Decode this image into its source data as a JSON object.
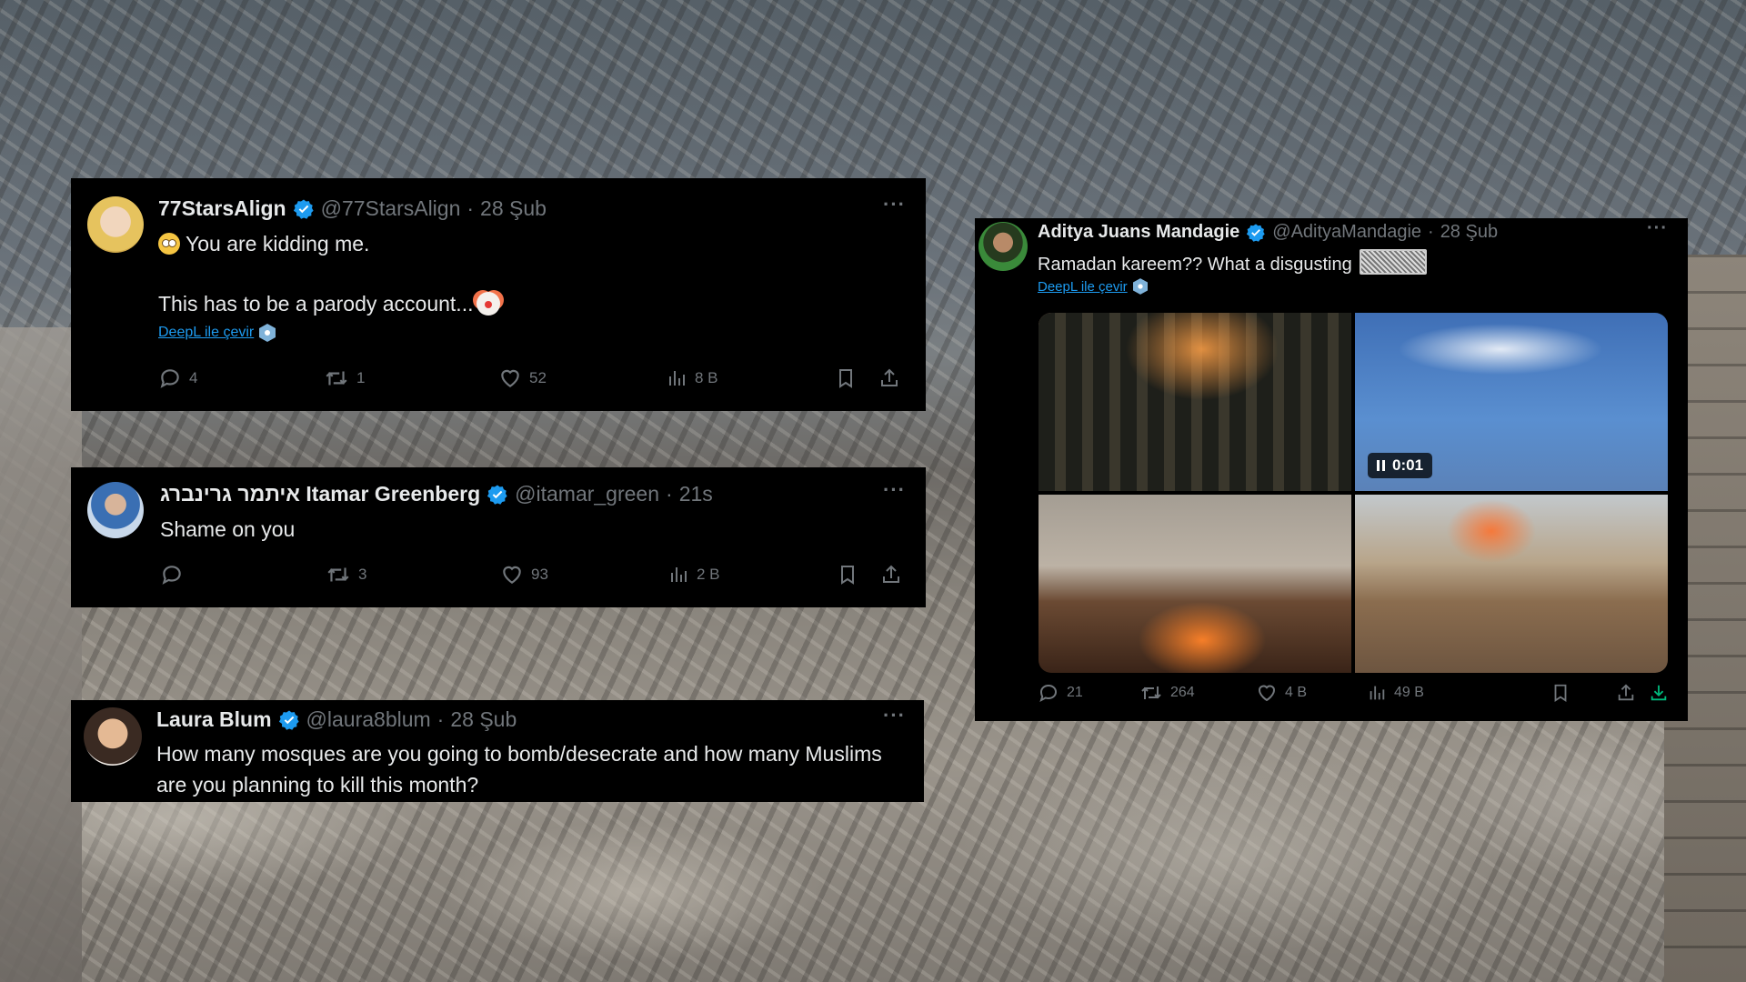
{
  "tweets": [
    {
      "name": "77StarsAlign",
      "handle": "@77StarsAlign",
      "sep": "·",
      "time": "28 Şub",
      "line1": "You are kidding me.",
      "line2": "This has to be a parody account...",
      "translate": "DeepL ile çevir",
      "replies": "4",
      "retweets": "1",
      "likes": "52",
      "views": "8 B"
    },
    {
      "name": "איתמר גרינברג Itamar Greenberg",
      "handle": "@itamar_green",
      "sep": "·",
      "time": "21s",
      "text": "Shame on you",
      "replies": "",
      "retweets": "3",
      "likes": "93",
      "views": "2 B"
    },
    {
      "name": "Laura Blum",
      "handle": "@laura8blum",
      "sep": "·",
      "time": "28 Şub",
      "text": "How many mosques are you going to bomb/desecrate and how many Muslims are you planning to kill this month?"
    },
    {
      "name": "Aditya Juans Mandagie",
      "handle": "@AdityaMandagie",
      "sep": "·",
      "time": "28 Şub",
      "text": "Ramadan kareem?? What a disgusting",
      "translate": "DeepL ile çevir",
      "video_time": "0:01",
      "replies": "21",
      "retweets": "264",
      "likes": "4 B",
      "views": "49 B"
    }
  ],
  "more_label": "···",
  "colors": {
    "card": "#000000",
    "text": "#e7e9ea",
    "muted": "#71767b",
    "accent": "#1d9bf0",
    "verified": "#1d9bf0"
  },
  "icons": [
    "verified-badge-icon",
    "more-icon",
    "reply-icon",
    "retweet-icon",
    "like-icon",
    "views-icon",
    "bookmark-icon",
    "share-icon",
    "download-icon",
    "deepl-icon",
    "pause-icon"
  ]
}
